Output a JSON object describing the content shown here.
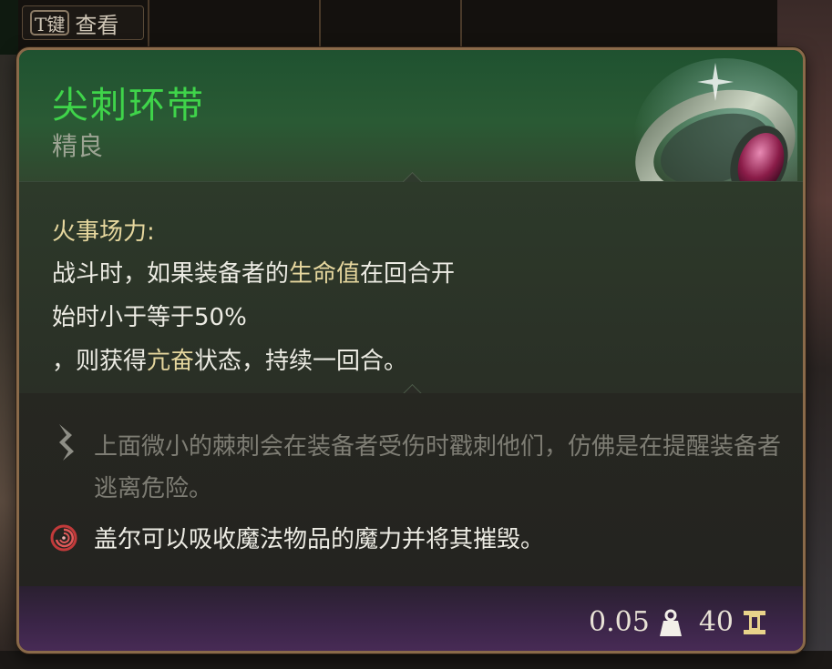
{
  "hint": {
    "key": "T键",
    "label": "查看"
  },
  "item": {
    "name": "尖刺环带",
    "rarity": "精良",
    "name_color": "#3fd44a"
  },
  "passive": {
    "title": "火事场力:",
    "line1_a": "战斗时，如果装备者的",
    "line1_hl": "生命值",
    "line1_b": "在回合开",
    "line2": "始时小于等于50%",
    "line3_a": "，则获得",
    "line3_hl": "亢奋",
    "line3_b": "状态，持续一回合。"
  },
  "lore": {
    "text": "上面微小的棘刺会在装备者受伤时戳刺他们，仿佛是在提醒装备者逃离危险。",
    "icon": "quill-icon"
  },
  "gale": {
    "text": "盖尔可以吸收魔法物品的魔力并将其摧毁。",
    "icon": "gale-spiral-icon"
  },
  "footer": {
    "weight": "0.05",
    "weight_icon": "weight-icon",
    "value": "40",
    "value_icon": "gold-coin-icon"
  },
  "colors": {
    "highlight": "#e6d79e",
    "header_green": "#2a5a34",
    "footer_purple": "#4a2c58",
    "border": "#8a6a4a"
  }
}
